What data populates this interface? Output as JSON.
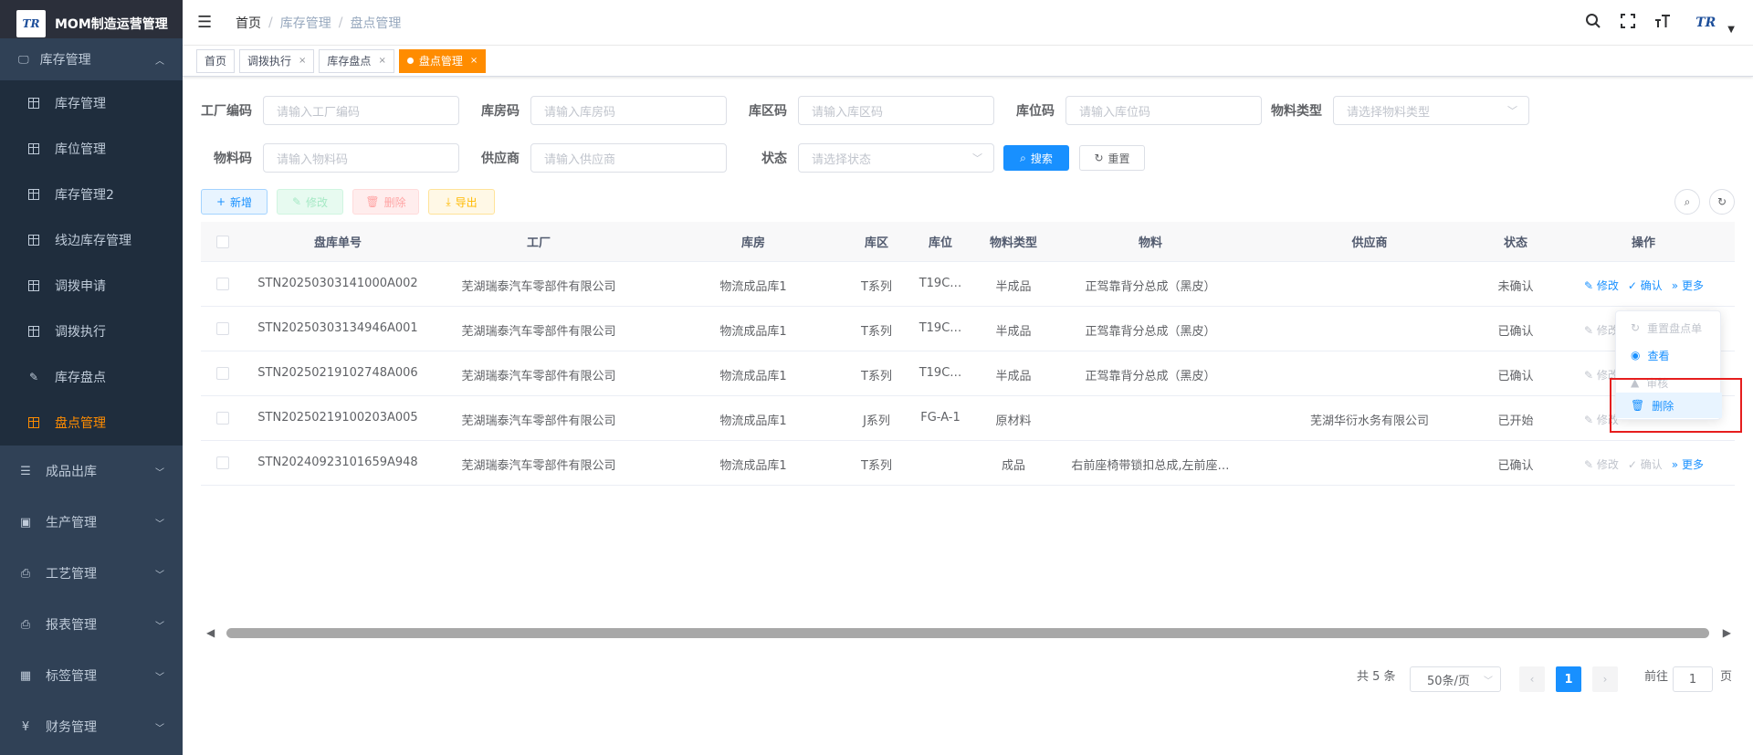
{
  "app": {
    "title": "MOM制造运营管理",
    "logo_text": "TR"
  },
  "sidebar": {
    "section": {
      "label": "库存管理"
    },
    "sub_items": [
      {
        "label": "库存管理"
      },
      {
        "label": "库位管理"
      },
      {
        "label": "库存管理2"
      },
      {
        "label": "线边库存管理"
      },
      {
        "label": "调拨申请"
      },
      {
        "label": "调拨执行"
      },
      {
        "label": "库存盘点"
      },
      {
        "label": "盘点管理",
        "active": true
      }
    ],
    "menus": [
      {
        "label": "成品出库",
        "icon": "list-icon"
      },
      {
        "label": "生产管理",
        "icon": "monitor-icon"
      },
      {
        "label": "工艺管理",
        "icon": "print-icon"
      },
      {
        "label": "报表管理",
        "icon": "print-icon"
      },
      {
        "label": "标签管理",
        "icon": "grid-icon"
      },
      {
        "label": "财务管理",
        "icon": "yen-icon"
      }
    ]
  },
  "header": {
    "breadcrumb": [
      "首页",
      "库存管理",
      "盘点管理"
    ],
    "avatar_text": "TR"
  },
  "tags": [
    {
      "label": "首页"
    },
    {
      "label": "调拨执行"
    },
    {
      "label": "库存盘点"
    },
    {
      "label": "盘点管理",
      "active": true
    }
  ],
  "filters": {
    "factory_code": {
      "label": "工厂编码",
      "placeholder": "请输入工厂编码"
    },
    "warehouse_code": {
      "label": "库房码",
      "placeholder": "请输入库房码"
    },
    "zone_code": {
      "label": "库区码",
      "placeholder": "请输入库区码"
    },
    "location_code": {
      "label": "库位码",
      "placeholder": "请输入库位码"
    },
    "material_type": {
      "label": "物料类型",
      "placeholder": "请选择物料类型"
    },
    "material_code": {
      "label": "物料码",
      "placeholder": "请输入物料码"
    },
    "supplier": {
      "label": "供应商",
      "placeholder": "请输入供应商"
    },
    "status": {
      "label": "状态",
      "placeholder": "请选择状态"
    },
    "search_label": "搜索",
    "reset_label": "重置"
  },
  "toolbar": {
    "add": "新增",
    "edit": "修改",
    "delete": "删除",
    "export": "导出"
  },
  "table": {
    "columns": [
      "盘库单号",
      "工厂",
      "库房",
      "库区",
      "库位",
      "物料类型",
      "物料",
      "供应商",
      "状态",
      "操作"
    ],
    "rows": [
      {
        "no": "STN20250303141000A002",
        "factory": "芜湖瑞泰汽车零部件有限公司",
        "warehouse": "物流成品库1",
        "zone": "T系列",
        "location": "T19C…",
        "mtype": "半成品",
        "material": "正驾靠背分总成（黑皮）",
        "supplier": "",
        "status": "未确认"
      },
      {
        "no": "STN20250303134946A001",
        "factory": "芜湖瑞泰汽车零部件有限公司",
        "warehouse": "物流成品库1",
        "zone": "T系列",
        "location": "T19C…",
        "mtype": "半成品",
        "material": "正驾靠背分总成（黑皮）",
        "supplier": "",
        "status": "已确认"
      },
      {
        "no": "STN20250219102748A006",
        "factory": "芜湖瑞泰汽车零部件有限公司",
        "warehouse": "物流成品库1",
        "zone": "T系列",
        "location": "T19C…",
        "mtype": "半成品",
        "material": "正驾靠背分总成（黑皮）",
        "supplier": "",
        "status": "已确认"
      },
      {
        "no": "STN20250219100203A005",
        "factory": "芜湖瑞泰汽车零部件有限公司",
        "warehouse": "物流成品库1",
        "zone": "J系列",
        "location": "FG-A-1",
        "mtype": "原材料",
        "material": "",
        "supplier": "芜湖华衍水务有限公司",
        "status": "已开始"
      },
      {
        "no": "STN20240923101659A948",
        "factory": "芜湖瑞泰汽车零部件有限公司",
        "warehouse": "物流成品库1",
        "zone": "T系列",
        "location": "",
        "mtype": "成品",
        "material": "右前座椅带锁扣总成,左前座…",
        "supplier": "",
        "status": "已确认"
      }
    ],
    "ops": {
      "edit": "修改",
      "confirm": "确认",
      "more": "更多"
    }
  },
  "dropdown": {
    "items": [
      {
        "label": "重置盘点单",
        "disabled": true
      },
      {
        "label": "查看",
        "disabled": false
      },
      {
        "label": "审核",
        "disabled": true
      },
      {
        "label": "删除",
        "disabled": false,
        "highlighted": true
      }
    ]
  },
  "pagination": {
    "total": "共 5 条",
    "page_size": "50条/页",
    "current": "1",
    "goto_prefix": "前往",
    "goto_value": "1",
    "goto_suffix": "页"
  }
}
